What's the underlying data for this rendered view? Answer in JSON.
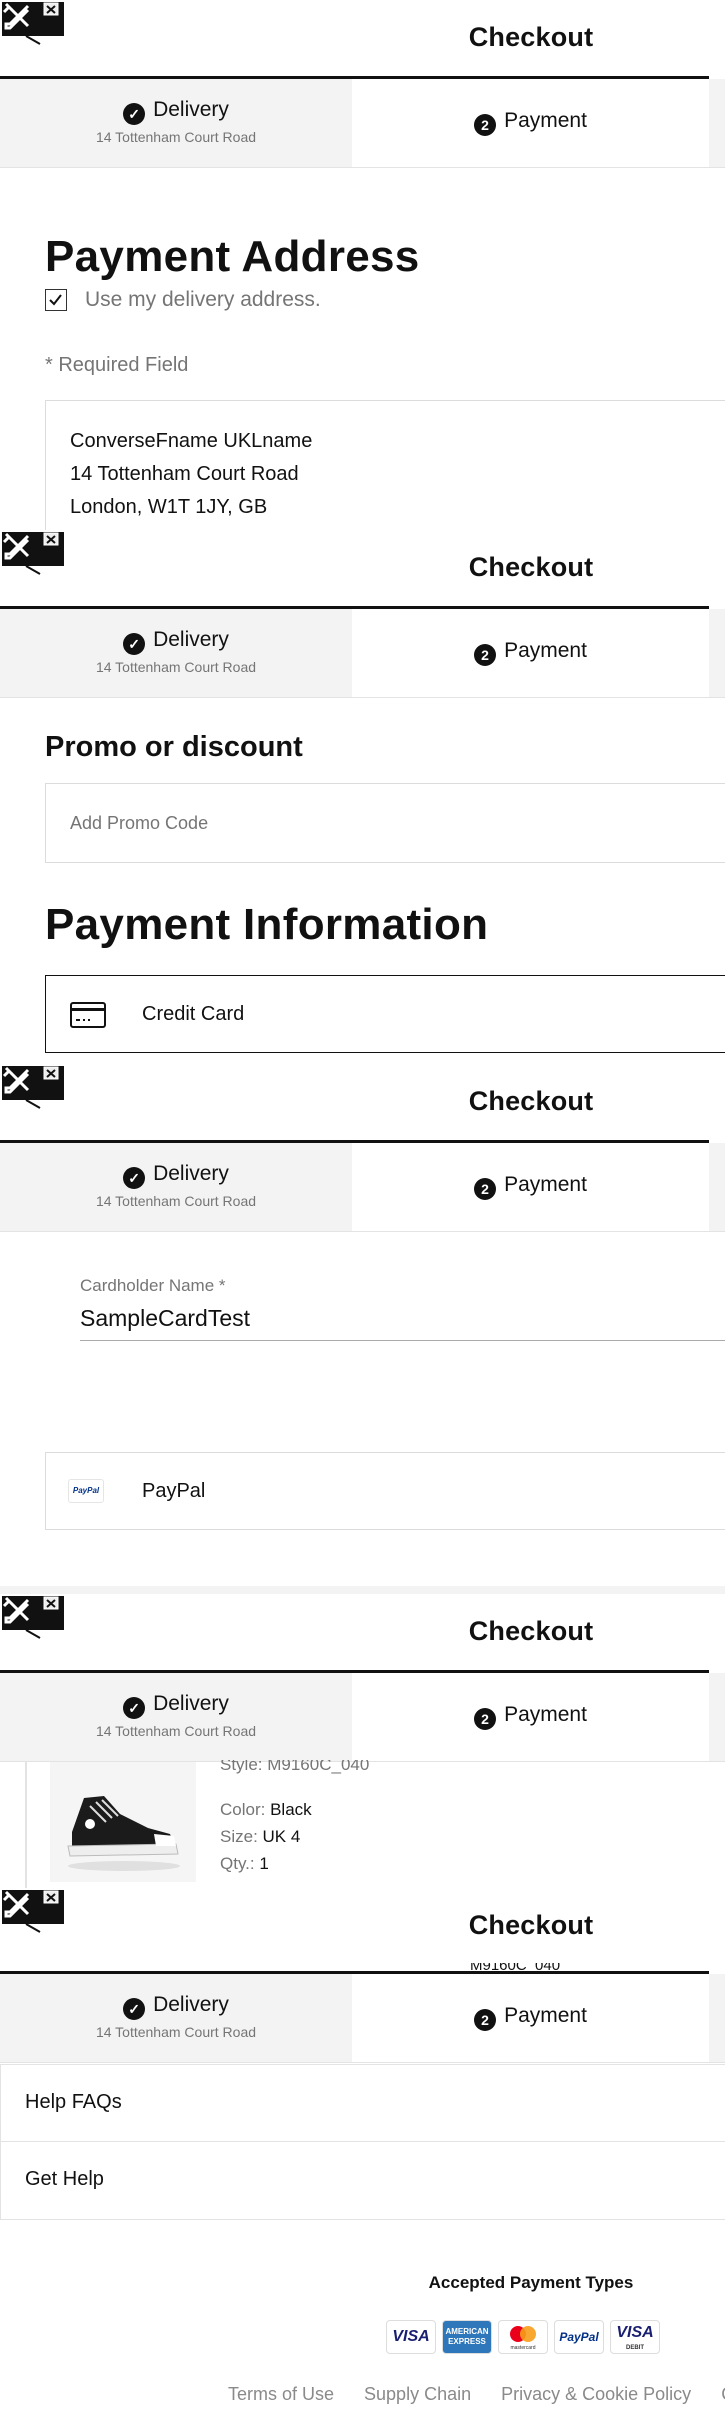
{
  "checkout": {
    "title": "Checkout",
    "delivery_label": "Delivery",
    "delivery_address": "14 Tottenham Court Road",
    "payment_step": "2",
    "payment_label": "Payment"
  },
  "payment_address": {
    "title": "Payment Address",
    "use_delivery_label": "Use my delivery address.",
    "use_delivery_checked": true,
    "required_note": "* Required Field",
    "name": "ConverseFname UKLname",
    "line1": "14 Tottenham Court Road",
    "line2": "London, W1T 1JY, GB"
  },
  "promo": {
    "title": "Promo or discount",
    "placeholder": "Add Promo Code"
  },
  "payment_info": {
    "title": "Payment Information",
    "credit_card_label": "Credit Card",
    "cardholder_label": "Cardholder Name",
    "required_star": "*",
    "cardholder_value": "SampleCardTest",
    "paypal_label": "PayPal",
    "paypal_logo_text": "PayPal"
  },
  "product": {
    "style": "Style: M9160C_040",
    "color_label": "Color:",
    "color_value": "Black",
    "size_label": "Size:",
    "size_value": "UK 4",
    "qty_label": "Qty.:",
    "qty_value": "1",
    "partial_text": "M9160C_040"
  },
  "help": {
    "faq_label": "Help FAQs",
    "get_help_label": "Get Help"
  },
  "footer": {
    "accepted_title": "Accepted Payment Types",
    "cards": [
      {
        "name": "visa-card-icon",
        "text": "VISA",
        "color": "#1a1f71"
      },
      {
        "name": "amex-card-icon",
        "text": "AMERICAN EXPRESS",
        "color": "#2e77bb"
      },
      {
        "name": "mastercard-card-icon",
        "text": "mastercard",
        "color": "#eb001b"
      },
      {
        "name": "paypal-card-icon",
        "text": "PayPal",
        "color": "#003087"
      },
      {
        "name": "visa-debit-card-icon",
        "text": "VISA",
        "sub": "DEBIT",
        "color": "#1a1f71"
      }
    ],
    "links": [
      "Terms of Use",
      "Supply Chain",
      "Privacy & Cookie Policy",
      "Co"
    ]
  },
  "colors": {
    "text": "#111111",
    "muted": "#757575",
    "step_inactive_bg": "#f3f3f3",
    "border": "#e3e3e3"
  }
}
